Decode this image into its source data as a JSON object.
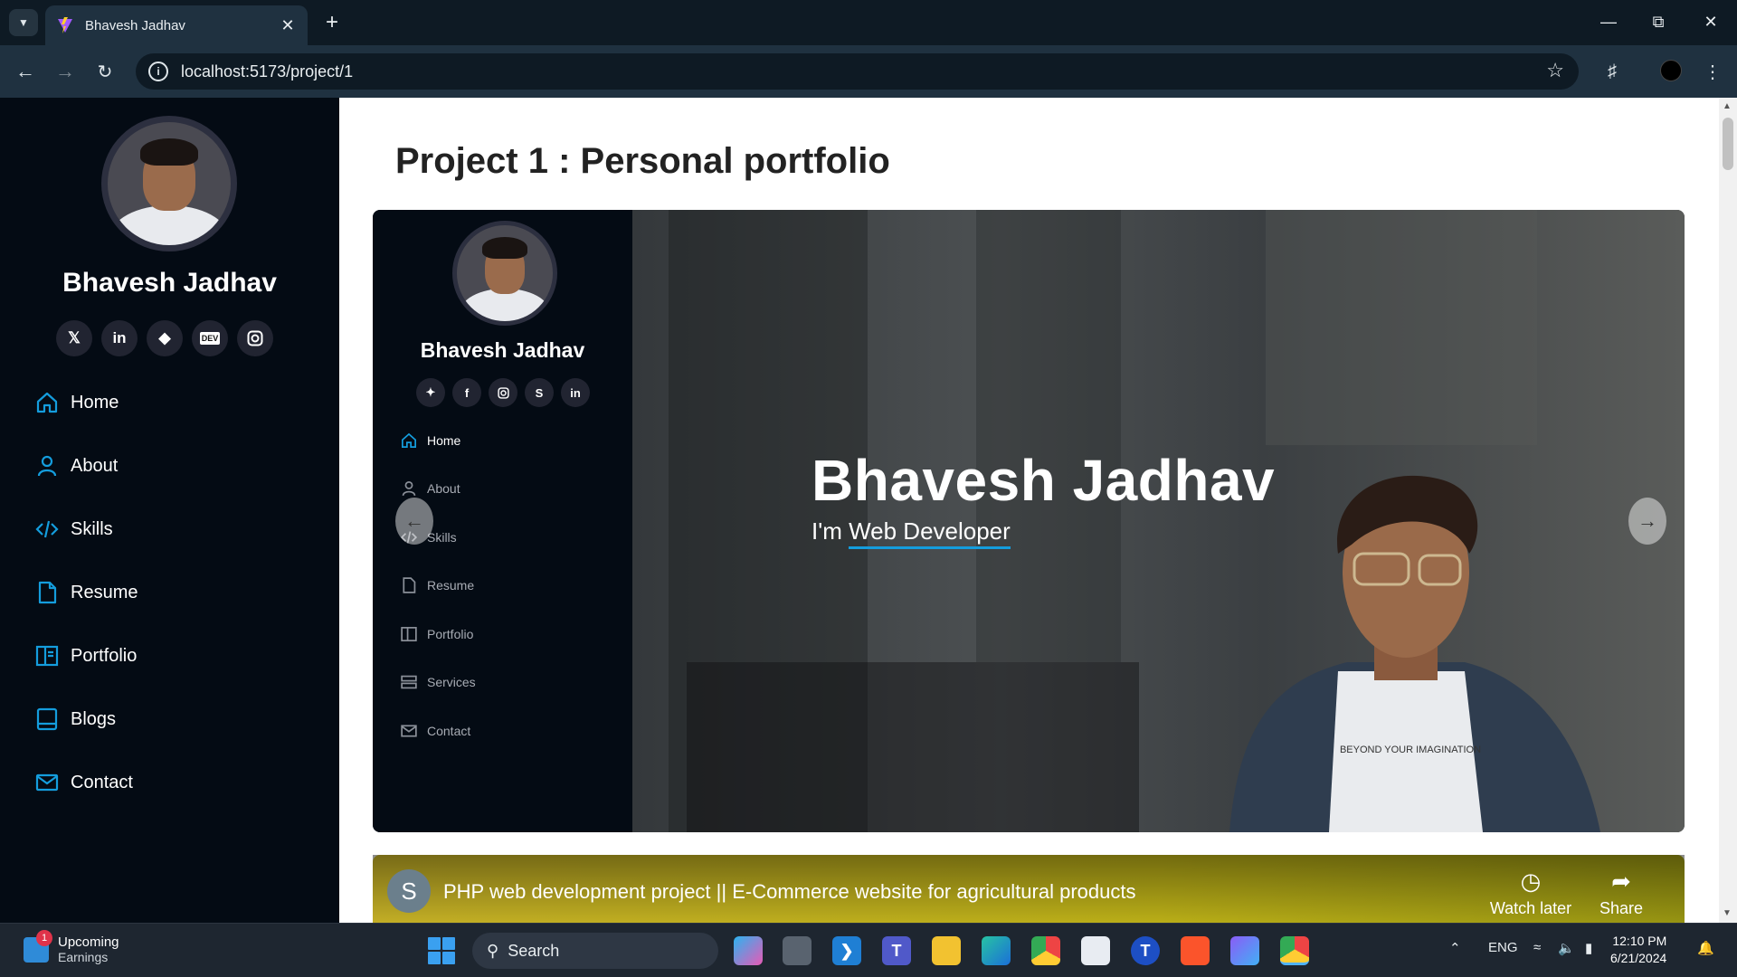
{
  "browser": {
    "tab_title": "Bhavesh Jadhav",
    "url": "localhost:5173/project/1"
  },
  "sidebar": {
    "name": "Bhavesh Jadhav",
    "socials": [
      "x-icon",
      "linkedin-icon",
      "gitlab-icon",
      "dev-icon",
      "instagram-icon"
    ],
    "socials_text": {
      "linkedin": "in",
      "dev": "DEV"
    },
    "items": [
      {
        "label": "Home",
        "icon": "home-icon"
      },
      {
        "label": "About",
        "icon": "person-icon"
      },
      {
        "label": "Skills",
        "icon": "code-icon"
      },
      {
        "label": "Resume",
        "icon": "file-icon"
      },
      {
        "label": "Portfolio",
        "icon": "book-icon"
      },
      {
        "label": "Blogs",
        "icon": "blog-icon"
      },
      {
        "label": "Contact",
        "icon": "envelope-icon"
      }
    ]
  },
  "main": {
    "title": "Project 1 : Personal portfolio"
  },
  "carousel": {
    "mini_name": "Bhavesh Jadhav",
    "mini_socials_text": {
      "linkedin": "in"
    },
    "mini_items": [
      {
        "label": "Home",
        "active": true
      },
      {
        "label": "About"
      },
      {
        "label": "Skills"
      },
      {
        "label": "Resume"
      },
      {
        "label": "Portfolio"
      },
      {
        "label": "Services"
      },
      {
        "label": "Contact"
      }
    ],
    "hero_name": "Bhavesh Jadhav",
    "hero_prefix": "I'm ",
    "hero_role": "Web Developer",
    "shirt_text": "BEYOND YOUR IMAGINATION"
  },
  "video": {
    "channel_initial": "S",
    "title": "PHP web development project || E-Commerce website for agricultural products",
    "watch_later": "Watch later",
    "share": "Share"
  },
  "taskbar": {
    "weather_title": "Upcoming",
    "weather_sub": "Earnings",
    "weather_badge": "1",
    "search": "Search",
    "lang": "ENG",
    "time": "12:10 PM",
    "date": "6/21/2024"
  },
  "colors": {
    "sidebar_bg": "#040b14",
    "accent": "#149ddd",
    "chrome_dark": "#0e1a24",
    "chrome_toolbar": "#1f3140"
  }
}
